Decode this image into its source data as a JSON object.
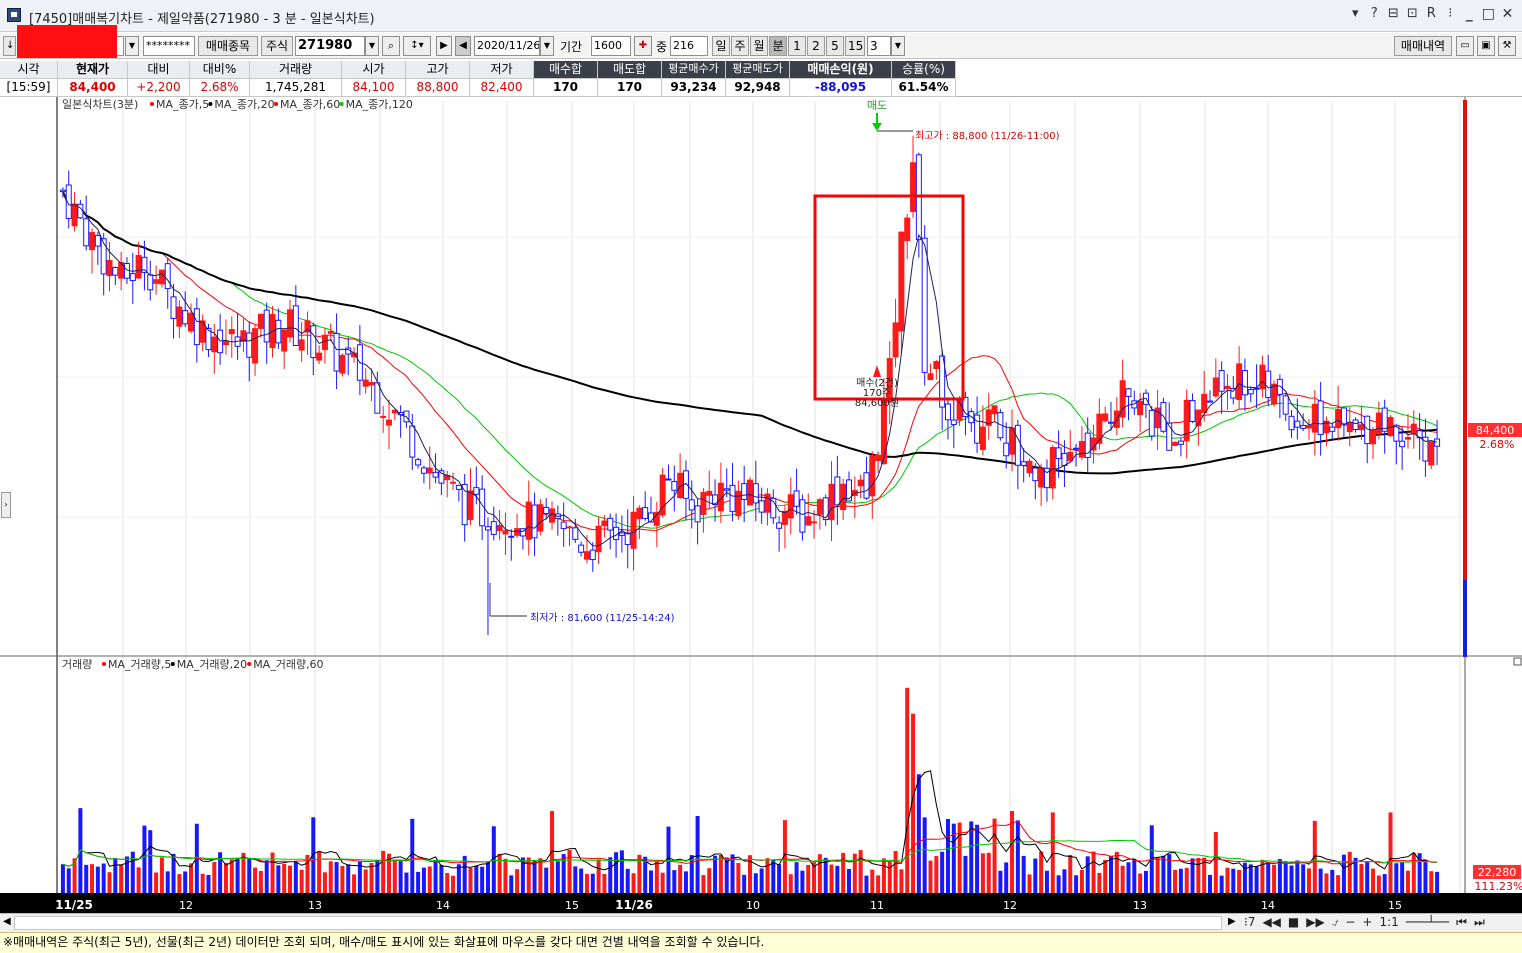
{
  "window": {
    "title": "[7450]매매복기차트 - 제일약품(271980 - 3 분 - 일본식차트)",
    "title_buttons": [
      "?",
      "?",
      "□",
      "⧉",
      "R",
      "…"
    ]
  },
  "toolbar": {
    "account_masked": "********",
    "trade_item_btn": "매매종목",
    "market_label": "주식",
    "code": "271980",
    "date": "2020/11/26",
    "period_label": "기간",
    "period_value": "1600",
    "weight_label": "중",
    "weight_value": "216",
    "intervals": [
      "일",
      "주",
      "월",
      "분",
      "1",
      "2",
      "5",
      "15",
      "3"
    ],
    "active_interval": "분",
    "trade_history_btn": "매매내역"
  },
  "info": {
    "time_header": "시각",
    "time_value": "[15:59]",
    "cur_header": "현재가",
    "cur_value": "84,400",
    "diff_header": "대비",
    "diff_value": "+2,200",
    "pct_header": "대비%",
    "pct_value": "2.68%",
    "vol_header": "거래량",
    "vol_value": "1,745,281",
    "open_header": "시가",
    "open_value": "84,100",
    "high_header": "고가",
    "high_value": "88,800",
    "low_header": "저가",
    "low_value": "82,400",
    "buysum_header": "매수합",
    "buysum_value": "170",
    "sellsum_header": "매도합",
    "sellsum_value": "170",
    "avgbuy_header": "평균매수가",
    "avgbuy_value": "93,234",
    "avgsell_header": "평균매도가",
    "avgsell_value": "92,948",
    "pnl_header": "매매손익(원)",
    "pnl_value": "-88,095",
    "win_header": "승률(%)",
    "win_value": "61.54%"
  },
  "price_legend": {
    "title": "일본식차트(3분)",
    "items": [
      {
        "label": "MA_종가,5",
        "color": "#ff0000"
      },
      {
        "label": "MA_종가,20",
        "color": "#000000"
      },
      {
        "label": "MA_종가,60",
        "color": "#ff0000"
      },
      {
        "label": "MA_종가,120",
        "color": "#00c800"
      }
    ]
  },
  "volume_legend": {
    "title": "거래량",
    "items": [
      {
        "label": "MA_거래량,5",
        "color": "#ff0000"
      },
      {
        "label": "MA_거래량,20",
        "color": "#000000"
      },
      {
        "label": "MA_거래량,60",
        "color": "#ff0000"
      }
    ]
  },
  "annotations": {
    "sell_marker": "매도",
    "high_label": "최고가 : 88,800 (11/26-11:00)",
    "low_label": "최저가 : 81,600 (11/25-14:24)",
    "buy_marker_l1": "매수(2건)",
    "buy_marker_l2": "170주",
    "buy_marker_l3": "84,600원"
  },
  "price_axis": {
    "current_price": "84,400",
    "current_pct": "2.68%"
  },
  "volume_axis": {
    "current_volume": "22,280",
    "current_pct": "111.23%"
  },
  "x_axis_labels": [
    "11/25",
    "12",
    "13",
    "14",
    "15",
    "11/26",
    "10",
    "11",
    "12",
    "13",
    "14",
    "15"
  ],
  "x_axis_bold": [
    "11/25",
    "11/26"
  ],
  "status": "※매매내역은 주식(최근 5년), 선물(최근 2년) 데이터만 조회 되며, 매수/매도 표시에 있는 화살표에 마우스를 갖다 대면 건별 내역을 조회할 수 있습니다.",
  "colors": {
    "up": "#ff1a1a",
    "down": "#1818ff",
    "ma5": "#ff0000",
    "ma20": "#000000",
    "ma60": "#ff0000",
    "ma120": "#00c800",
    "highlight_box": "#ff0000",
    "sell_arrow": "#00d000"
  },
  "chart_data": {
    "type": "candlestick",
    "price_ylim": [
      81300,
      89300
    ],
    "high": 88800,
    "low": 81600,
    "current": 84400,
    "series": [
      {
        "name": "MA_종가,5"
      },
      {
        "name": "MA_종가,20"
      },
      {
        "name": "MA_종가,60"
      },
      {
        "name": "MA_종가,120"
      }
    ]
  }
}
